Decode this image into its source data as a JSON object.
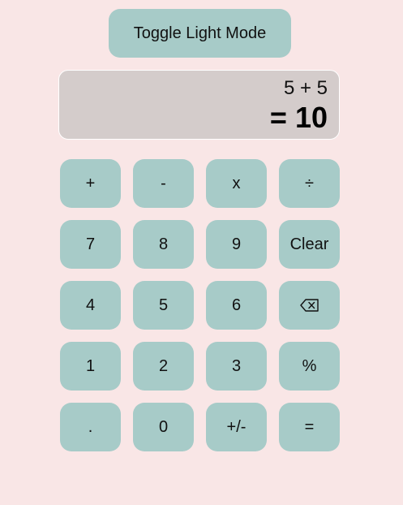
{
  "toggle": {
    "label": "Toggle Light Mode"
  },
  "display": {
    "expression": "5 + 5",
    "result": "= 10"
  },
  "keys": [
    {
      "name": "plus-button",
      "label": "+"
    },
    {
      "name": "minus-button",
      "label": "-"
    },
    {
      "name": "multiply-button",
      "label": "x"
    },
    {
      "name": "divide-button",
      "label": "÷"
    },
    {
      "name": "digit-7-button",
      "label": "7"
    },
    {
      "name": "digit-8-button",
      "label": "8"
    },
    {
      "name": "digit-9-button",
      "label": "9"
    },
    {
      "name": "clear-button",
      "label": "Clear"
    },
    {
      "name": "digit-4-button",
      "label": "4"
    },
    {
      "name": "digit-5-button",
      "label": "5"
    },
    {
      "name": "digit-6-button",
      "label": "6"
    },
    {
      "name": "backspace-button",
      "label": "",
      "icon": "backspace-icon"
    },
    {
      "name": "digit-1-button",
      "label": "1"
    },
    {
      "name": "digit-2-button",
      "label": "2"
    },
    {
      "name": "digit-3-button",
      "label": "3"
    },
    {
      "name": "percent-button",
      "label": "%"
    },
    {
      "name": "decimal-button",
      "label": "."
    },
    {
      "name": "digit-0-button",
      "label": "0"
    },
    {
      "name": "negate-button",
      "label": "+/-"
    },
    {
      "name": "equals-button",
      "label": "="
    }
  ],
  "colors": {
    "background": "#f9e6e6",
    "button": "#a7cbc8",
    "display": "#d4cccb"
  }
}
